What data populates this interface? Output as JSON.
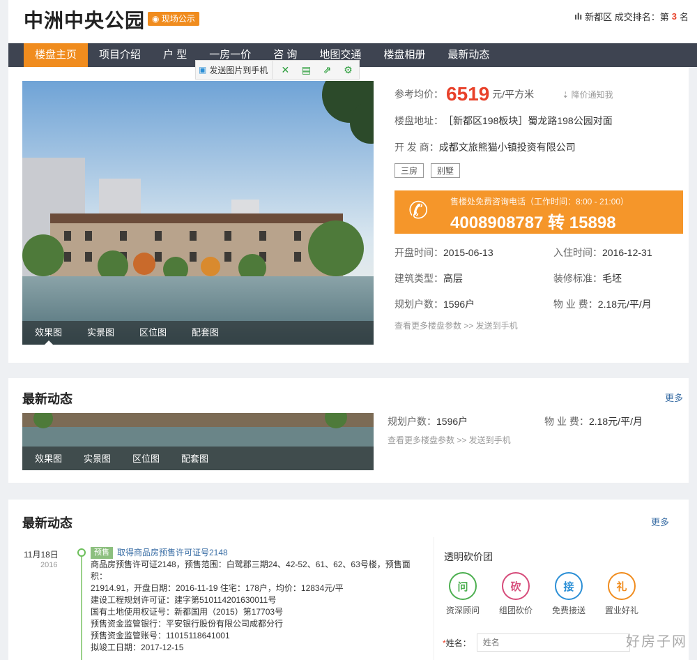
{
  "header": {
    "title": "中洲中央公园",
    "badge": "现场公示",
    "rank_prefix": "新都区 成交排名：第",
    "rank_num": "3",
    "rank_suffix": "名"
  },
  "nav": {
    "items": [
      "楼盘主页",
      "项目介绍",
      "户 型",
      "一房一价",
      "咨 询",
      "地图交通",
      "楼盘相册",
      "最新动态"
    ],
    "active_index": 0
  },
  "tools": {
    "send_label": "发送图片到手机"
  },
  "photo_tabs": [
    "效果图",
    "实景图",
    "区位图",
    "配套图"
  ],
  "info": {
    "price_label": "参考均价：",
    "price": "6519",
    "price_unit": "元/平方米",
    "price_notify": "降价通知我",
    "address_label": "楼盘地址：",
    "address": "［新都区198板块］蜀龙路198公园对面",
    "developer_label": "开 发 商：",
    "developer": "成都文旅熊猫小镇投资有限公司",
    "tags": [
      "三房",
      "别墅"
    ],
    "hotline_note": "售楼处免费咨询电话（工作时间：8:00 - 21:00）",
    "hotline": "4008908787 转 15898",
    "open_label": "开盘时间：",
    "open": "2015-06-13",
    "checkin_label": "入住时间：",
    "checkin": "2016-12-31",
    "type_label": "建筑类型：",
    "type": "高层",
    "decor_label": "装修标准：",
    "decor": "毛坯",
    "households_label": "规划户数：",
    "households": "1596户",
    "fee_label": "物 业 费：",
    "fee": "2.18元/平/月",
    "more": "查看更多楼盘参数 >> 发送到手机"
  },
  "section": {
    "title": "最新动态",
    "more": "更多"
  },
  "news": {
    "date": "11月18日",
    "year": "2016",
    "tag": "预售",
    "title": "取得商品房预售许可证号2148",
    "lines": [
      "商品房预售许可证2148，预售范围：白鹭郡三期24、42-52、61、62、63号楼，预售面积：",
      "21914.91，开盘日期：2016-11-19 住宅：178户，均价：12834元/平",
      "建设工程规划许可证：建字第510114201630011号",
      "国有土地使用权证号：新都国用（2015）第17703号",
      "预售资金监管银行：平安银行股份有限公司成都分行",
      "预售资金监管账号：11015118641001",
      "拟竣工日期：2017-12-15"
    ]
  },
  "group": {
    "title": "透明砍价团",
    "items": [
      {
        "glyph": "问",
        "label": "资深顾问",
        "color": "#4caf50"
      },
      {
        "glyph": "砍",
        "label": "组团砍价",
        "color": "#d64b7a"
      },
      {
        "glyph": "接",
        "label": "免费接送",
        "color": "#2b8fd6"
      },
      {
        "glyph": "礼",
        "label": "置业好礼",
        "color": "#f08c1e"
      }
    ],
    "name_label": "姓名：",
    "name_placeholder": "姓名"
  },
  "watermark": "好房子网"
}
